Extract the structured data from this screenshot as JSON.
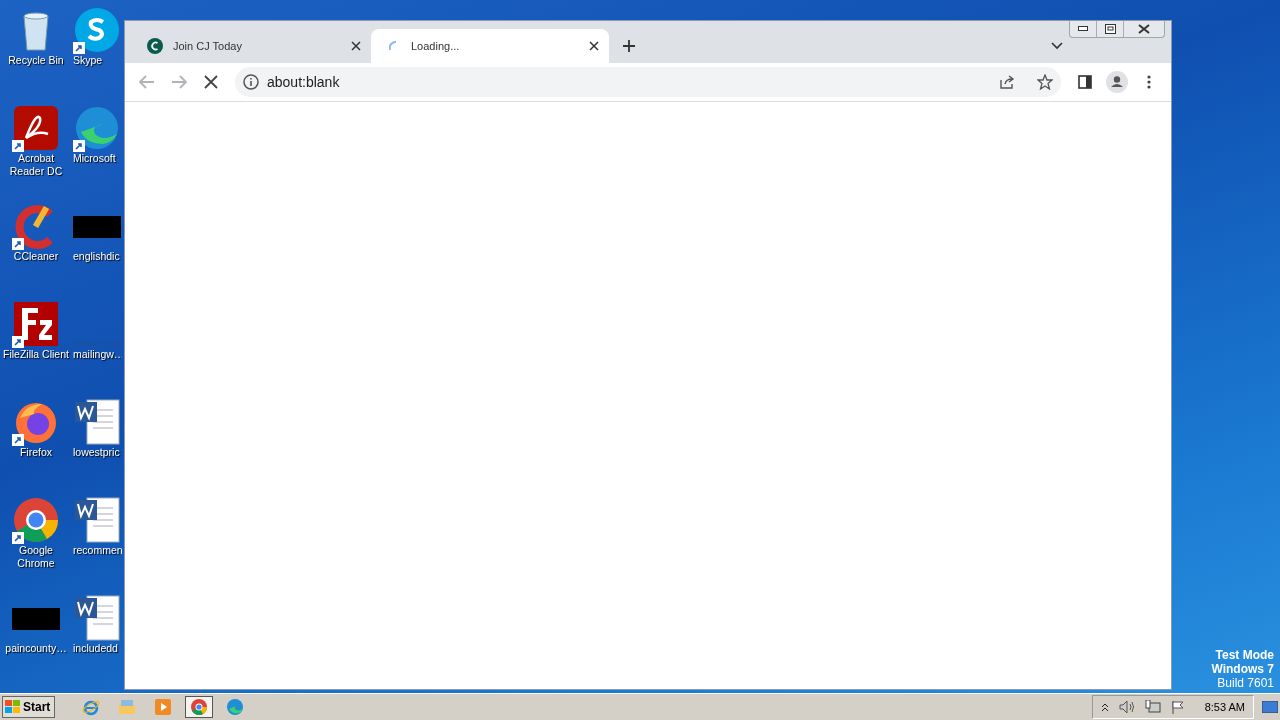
{
  "desktop_icons": [
    {
      "label": "Recycle Bin",
      "kind": "recycle"
    },
    {
      "label": "Acrobat Reader DC",
      "kind": "acrobat"
    },
    {
      "label": "CCleaner",
      "kind": "ccleaner"
    },
    {
      "label": "FileZilla Client",
      "kind": "filezilla"
    },
    {
      "label": "Firefox",
      "kind": "firefox"
    },
    {
      "label": "Google Chrome",
      "kind": "chrome"
    },
    {
      "label": "paincounty…",
      "kind": "black"
    },
    {
      "label": "Skype",
      "kind": "skype"
    },
    {
      "label": "Microsoft",
      "kind": "edge"
    },
    {
      "label": "englishdic",
      "kind": "black"
    },
    {
      "label": "mailingw…",
      "kind": "blank"
    },
    {
      "label": "lowestpric",
      "kind": "word"
    },
    {
      "label": "recommen",
      "kind": "word"
    },
    {
      "label": "includedd",
      "kind": "word"
    }
  ],
  "browser": {
    "tabs": [
      {
        "title": "Join CJ Today",
        "selected": false,
        "kind": "site"
      },
      {
        "title": "Loading...",
        "selected": true,
        "kind": "loading"
      }
    ],
    "address": "about:blank"
  },
  "watermark_text": [
    "Test Mode",
    "Windows 7",
    "Build 7601"
  ],
  "taskbar": {
    "start": "Start",
    "apps": [
      {
        "kind": "ie",
        "selected": false
      },
      {
        "kind": "folder",
        "selected": false
      },
      {
        "kind": "media",
        "selected": false
      },
      {
        "kind": "chrome",
        "selected": true
      },
      {
        "kind": "edge",
        "selected": false
      }
    ],
    "clock": "8:53 AM"
  }
}
